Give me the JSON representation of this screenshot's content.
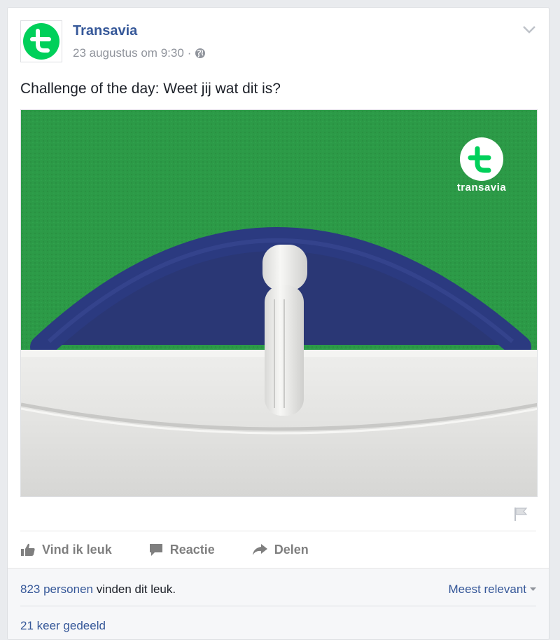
{
  "post": {
    "page_name": "Transavia",
    "timestamp": "23 augustus om 9:30",
    "separator": "·",
    "privacy_icon": "globe-icon",
    "text": "Challenge of the day: Weet jij wat dit is?",
    "photo": {
      "brand_label": "transavia",
      "colors": {
        "background": "#2c9a47",
        "handle": "#2a3775",
        "panel": "#e6e6e4",
        "latch": "#f0f0ee",
        "logo": "#00d05a"
      }
    }
  },
  "actions": {
    "like_label": "Vind ik leuk",
    "comment_label": "Reactie",
    "share_label": "Delen"
  },
  "footer": {
    "like_count_link": "823 personen",
    "like_suffix": " vinden dit leuk.",
    "sort_label": "Meest relevant",
    "shares_label": "21 keer gedeeld"
  },
  "colors": {
    "brand_green": "#00d05a",
    "link": "#365899",
    "muted": "#90949c"
  }
}
